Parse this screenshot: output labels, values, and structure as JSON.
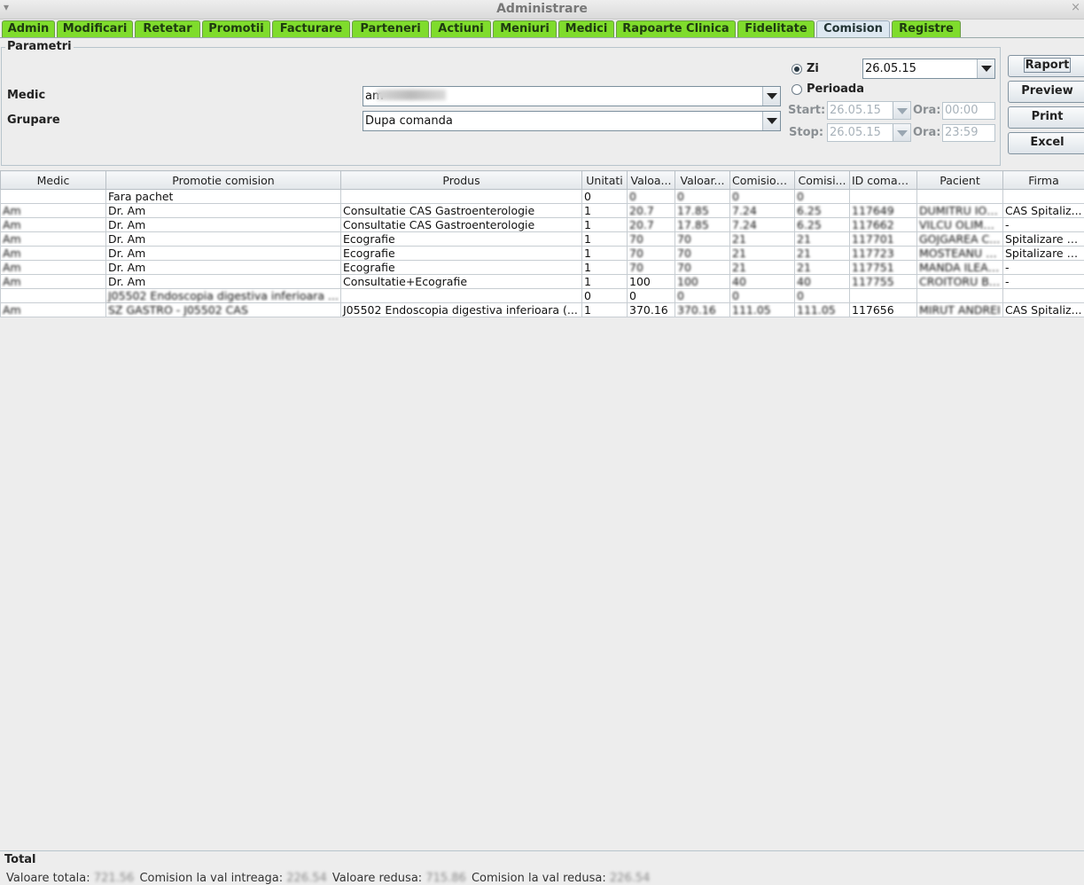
{
  "window": {
    "title": "Administrare",
    "menu_glyph": "▾",
    "close_glyph": "×"
  },
  "tabs": [
    "Admin",
    "Modificari",
    "Retetar",
    "Promotii",
    "Facturare",
    "Parteneri",
    "Actiuni",
    "Meniuri",
    "Medici",
    "Rapoarte Clinica",
    "Fidelitate",
    "Comision",
    "Registre"
  ],
  "active_tab": "Comision",
  "params": {
    "title": "Parametri",
    "medic_label": "Medic",
    "medic_value": "am",
    "grupare_label": "Grupare",
    "grupare_value": "Dupa comanda",
    "zi_label": "Zi",
    "zi_value": "26.05.15",
    "perioada_label": "Perioada",
    "start_label": "Start:",
    "start_value": "26.05.15",
    "stop_label": "Stop:",
    "stop_value": "26.05.15",
    "ora_label": "Ora:",
    "ora_start": "00:00",
    "ora_stop": "23:59",
    "mode": "zi"
  },
  "buttons": {
    "raport": "Raport",
    "preview": "Preview",
    "print": "Print",
    "excel": "Excel"
  },
  "table": {
    "columns": [
      "Medic",
      "Promotie comision",
      "Produs",
      "Unitati",
      "Valoa...",
      "Valoar...",
      "Comision...",
      "Comisi...",
      "ID coman...",
      "Pacient",
      "Firma"
    ],
    "rows": [
      [
        "",
        "Fara pachet",
        "",
        "0",
        "0",
        "0",
        "0",
        "0",
        "",
        "",
        ""
      ],
      [
        "Am",
        "Dr. Am",
        "Consultatie CAS Gastroenterologie",
        "1",
        "20.7",
        "17.85",
        "7.24",
        "6.25",
        "117649",
        "DUMITRU ION...",
        "CAS Spitaliz..."
      ],
      [
        "Am",
        "Dr. Am",
        "Consultatie CAS Gastroenterologie",
        "1",
        "20.7",
        "17.85",
        "7.24",
        "6.25",
        "117662",
        "VILCU OLIMPIA",
        "-"
      ],
      [
        "Am",
        "Dr. Am",
        "Ecografie",
        "1",
        "70",
        "70",
        "21",
        "21",
        "117701",
        "GOJGAREA C...",
        "Spitalizare A..."
      ],
      [
        "Am",
        "Dr. Am",
        "Ecografie",
        "1",
        "70",
        "70",
        "21",
        "21",
        "117723",
        "MOSTEANU P...",
        "Spitalizare A..."
      ],
      [
        "Am",
        "Dr. Am",
        "Ecografie",
        "1",
        "70",
        "70",
        "21",
        "21",
        "117751",
        "MANDA ILEANA",
        "-"
      ],
      [
        "Am",
        "Dr. Am",
        "Consultatie+Ecografie",
        "1",
        "100",
        "100",
        "40",
        "40",
        "117755",
        "CROITORU BO...",
        "-"
      ],
      [
        "",
        "J05502 Endoscopia digestiva inferioara ...",
        "",
        "0",
        "0",
        "0",
        "0",
        "0",
        "",
        "",
        ""
      ],
      [
        "Am",
        "SZ GASTRO - J05502 CAS",
        "J05502 Endoscopia digestiva inferioara (...",
        "1",
        "370.16",
        "370.16",
        "111.05",
        "111.05",
        "117656",
        "MIRUT ANDREI",
        "CAS Spitaliz..."
      ]
    ]
  },
  "total": {
    "title": "Total",
    "valoare_totala_label": "Valoare totala:",
    "valoare_totala": "721.56",
    "comision_intreaga_label": "Comision la val intreaga:",
    "comision_intreaga": "226.54",
    "valoare_redusa_label": "Valoare redusa:",
    "valoare_redusa": "715.86",
    "comision_redusa_label": "Comision la val redusa:",
    "comision_redusa": "226.54"
  }
}
